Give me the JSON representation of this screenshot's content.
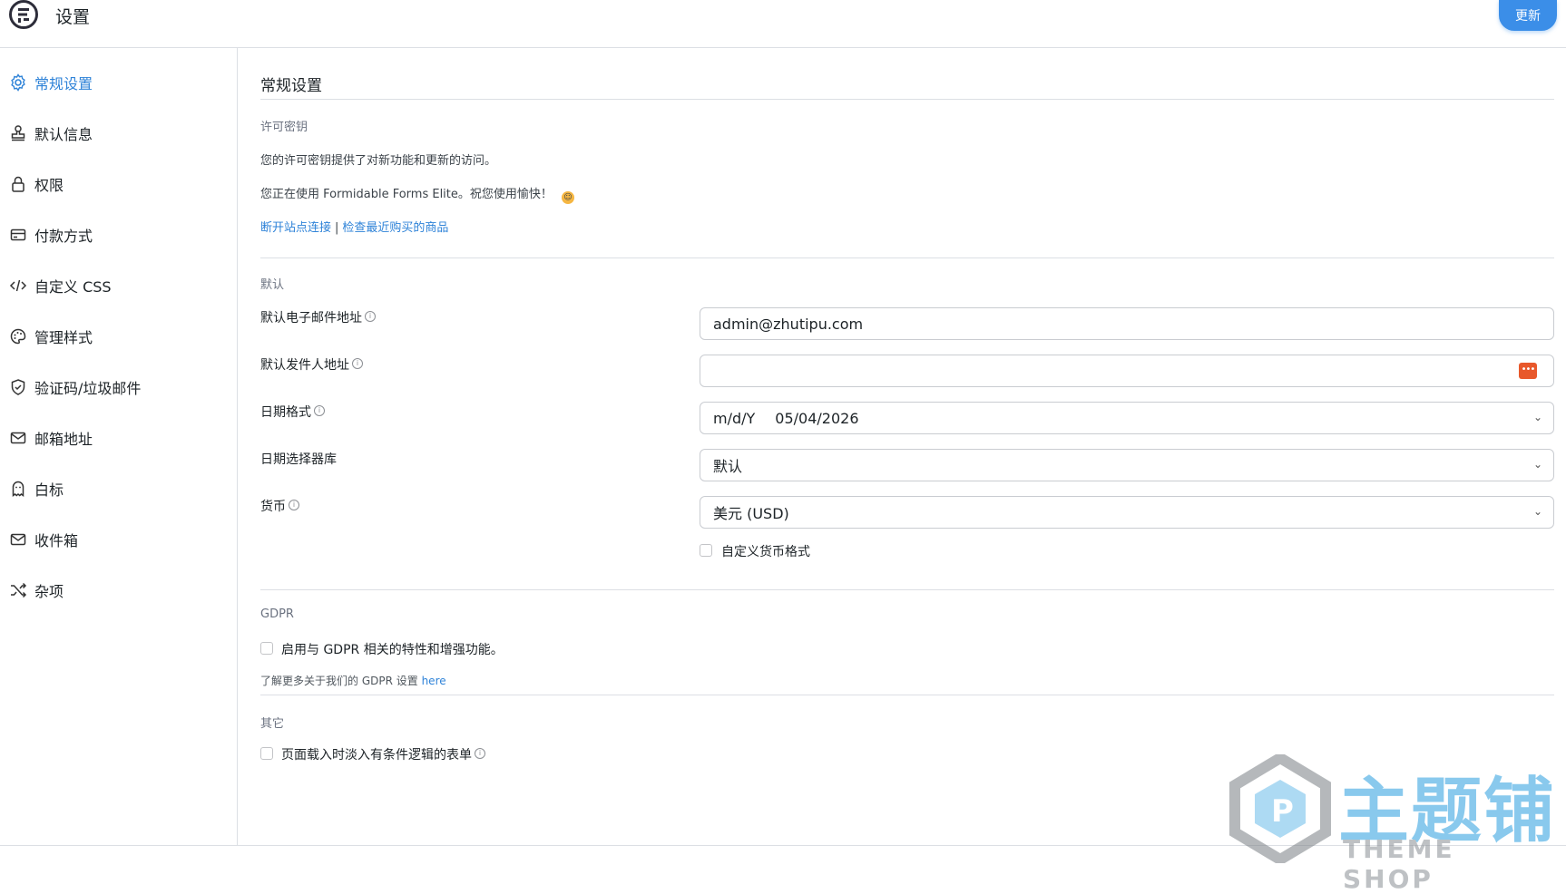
{
  "header": {
    "title": "设置",
    "update_label": "更新"
  },
  "sidebar": {
    "items": [
      {
        "label": "常规设置",
        "icon": "gear-icon",
        "active": true
      },
      {
        "label": "默认信息",
        "icon": "stamp-icon"
      },
      {
        "label": "权限",
        "icon": "lock-icon"
      },
      {
        "label": "付款方式",
        "icon": "credit-card-icon"
      },
      {
        "label": "自定义 CSS",
        "icon": "code-icon"
      },
      {
        "label": "管理样式",
        "icon": "palette-icon"
      },
      {
        "label": "验证码/垃圾邮件",
        "icon": "shield-icon"
      },
      {
        "label": "邮箱地址",
        "icon": "envelope-icon"
      },
      {
        "label": "白标",
        "icon": "ghost-icon"
      },
      {
        "label": "收件箱",
        "icon": "inbox-icon"
      },
      {
        "label": "杂项",
        "icon": "shuffle-icon"
      }
    ]
  },
  "main": {
    "title": "常规设置",
    "license": {
      "section_label": "许可密钥",
      "description": "您的许可密钥提供了对新功能和更新的访问。",
      "status": "您正在使用 Formidable Forms Elite。祝您使用愉快！",
      "disconnect_link": "断开站点连接",
      "separator": "|",
      "check_link": "检查最近购买的商品"
    },
    "defaults": {
      "section_label": "默认",
      "email_label": "默认电子邮件地址",
      "email_value": "admin@zhutipu.com",
      "from_label": "默认发件人地址",
      "from_value": "",
      "date_format_label": "日期格式",
      "date_format_value": "m/d/Y",
      "date_format_example": "05/04/2026",
      "datepicker_label": "日期选择器库",
      "datepicker_value": "默认",
      "currency_label": "货币",
      "currency_value": "美元 (USD)",
      "custom_currency_label": "自定义货币格式",
      "custom_currency_checked": false
    },
    "gdpr": {
      "section_label": "GDPR",
      "enable_label": "启用与 GDPR 相关的特性和增强功能。",
      "enable_checked": false,
      "note_prefix": "了解更多关于我们的 GDPR 设置",
      "note_link": "here"
    },
    "other": {
      "section_label": "其它",
      "fade_label": "页面载入时淡入有条件逻辑的表单",
      "fade_checked": false
    }
  },
  "watermark": {
    "main": "主题铺",
    "sub": "THEME SHOP"
  },
  "colors": {
    "accent": "#2f83d8",
    "button": "#3b8ee8",
    "password_icon": "#e8582b"
  }
}
